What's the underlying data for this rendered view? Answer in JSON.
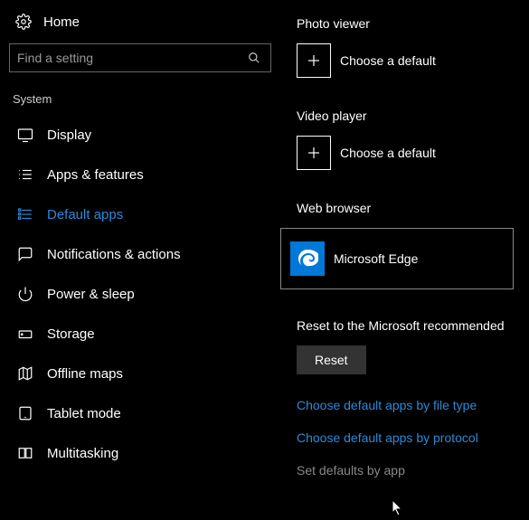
{
  "home_label": "Home",
  "search": {
    "placeholder": "Find a setting"
  },
  "section": "System",
  "sidebar": {
    "items": [
      {
        "label": "Display"
      },
      {
        "label": "Apps & features"
      },
      {
        "label": "Default apps"
      },
      {
        "label": "Notifications & actions"
      },
      {
        "label": "Power & sleep"
      },
      {
        "label": "Storage"
      },
      {
        "label": "Offline maps"
      },
      {
        "label": "Tablet mode"
      },
      {
        "label": "Multitasking"
      }
    ]
  },
  "defaults": {
    "photo": {
      "title": "Photo viewer",
      "action": "Choose a default"
    },
    "video": {
      "title": "Video player",
      "action": "Choose a default"
    },
    "web": {
      "title": "Web browser",
      "app": "Microsoft Edge"
    }
  },
  "reset": {
    "label": "Reset to the Microsoft recommended",
    "button": "Reset"
  },
  "links": {
    "by_file_type": "Choose default apps by file type",
    "by_protocol": "Choose default apps by protocol",
    "by_app": "Set defaults by app"
  },
  "colors": {
    "accent": "#2b8ad6",
    "edge_bg": "#0078d7"
  }
}
